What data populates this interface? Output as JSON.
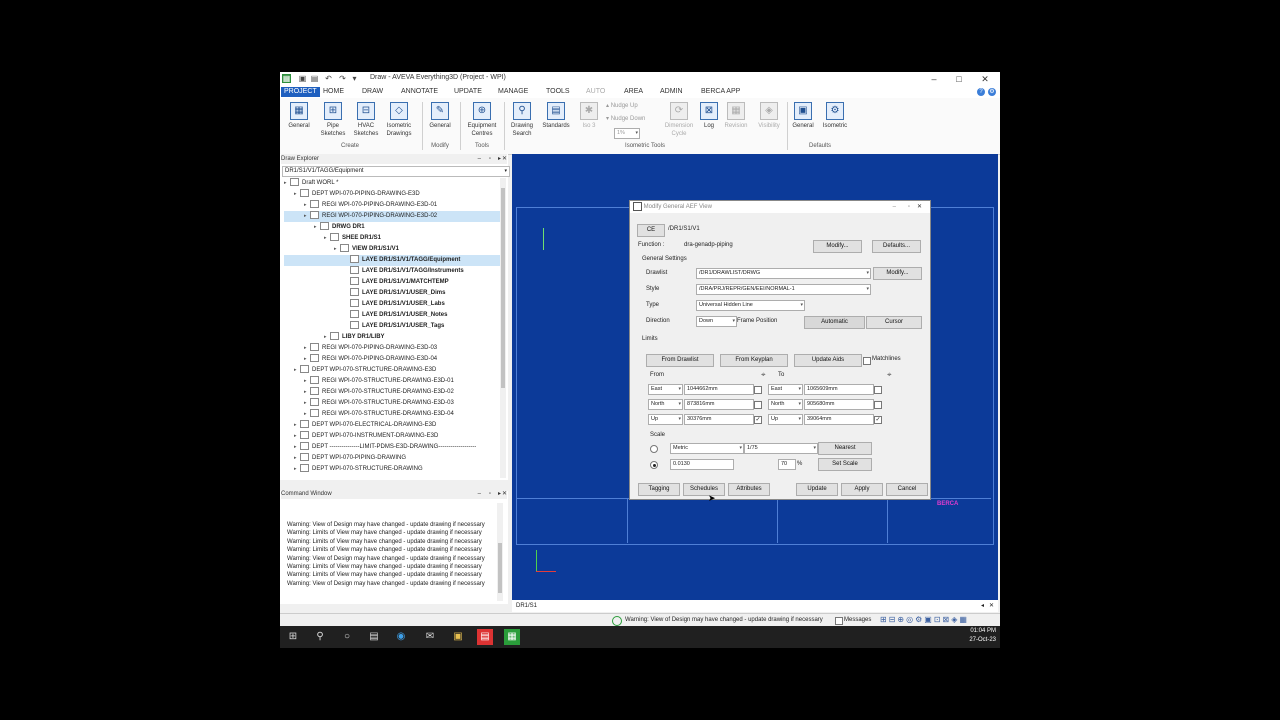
{
  "window": {
    "title": "Draw - AVEVA Everything3D (Project - WPI)",
    "controls": [
      "–",
      "□",
      "✕"
    ]
  },
  "menu": {
    "items": [
      "PROJECT",
      "HOME",
      "DRAW",
      "ANNOTATE",
      "UPDATE",
      "MANAGE",
      "TOOLS",
      "AUTO",
      "AREA",
      "ADMIN",
      "BERCA APP"
    ],
    "active": "PROJECT"
  },
  "ribbon": {
    "create": {
      "general": "General",
      "pipe": "Pipe Sketches",
      "hvac": "HVAC Sketches",
      "isometric": "Isometric Drawings",
      "group": "Create"
    },
    "modify": {
      "general": "General",
      "group": "Modify"
    },
    "tools": {
      "equipment": "Equipment Centres",
      "group": "Tools"
    },
    "drawing_search": "Drawing Search",
    "standards": "Standards",
    "iso3": "Iso 3",
    "nudge_up": "Nudge Up",
    "nudge_down": "Nudge Down",
    "percent": "1%",
    "dimension_cycle": "Dimension Cycle",
    "log": "Log",
    "revision": "Revision",
    "visibility": "Visibility",
    "isometric_tools_group": "Isometric Tools",
    "defaults": {
      "general": "General",
      "isometric": "Isometric",
      "group": "Defaults"
    }
  },
  "draw_explorer": {
    "title": "Draw Explorer",
    "path": "DR1/S1/V1/TAGG/Equipment",
    "tree": [
      {
        "text": "Draft WORL *",
        "level": 0,
        "bold": false
      },
      {
        "text": "DEPT WPI-070-PIPING-DRAWING-E3D",
        "level": 1,
        "bold": false
      },
      {
        "text": "REGI WPI-070-PIPING-DRAWING-E3D-01",
        "level": 2,
        "bold": false
      },
      {
        "text": "REGI WPI-070-PIPING-DRAWING-E3D-02",
        "level": 2,
        "bold": false,
        "selected": true
      },
      {
        "text": "DRWG DR1",
        "level": 3,
        "bold": true
      },
      {
        "text": "SHEE DR1/S1",
        "level": 4,
        "bold": true
      },
      {
        "text": "VIEW DR1/S1/V1",
        "level": 5,
        "bold": true
      },
      {
        "text": "LAYE DR1/S1/V1/TAGG/Equipment",
        "level": 6,
        "bold": true,
        "selected": true
      },
      {
        "text": "LAYE DR1/S1/V1/TAGG/Instruments",
        "level": 6,
        "bold": true
      },
      {
        "text": "LAYE DR1/S1/V1/MATCHTEMP",
        "level": 6,
        "bold": true
      },
      {
        "text": "LAYE DR1/S1/V1/USER_Dims",
        "level": 6,
        "bold": true
      },
      {
        "text": "LAYE DR1/S1/V1/USER_Labs",
        "level": 6,
        "bold": true
      },
      {
        "text": "LAYE DR1/S1/V1/USER_Notes",
        "level": 6,
        "bold": true
      },
      {
        "text": "LAYE DR1/S1/V1/USER_Tags",
        "level": 6,
        "bold": true
      },
      {
        "text": "LIBY DR1/LIBY",
        "level": 4,
        "bold": true
      },
      {
        "text": "REGI WPI-070-PIPING-DRAWING-E3D-03",
        "level": 2,
        "bold": false
      },
      {
        "text": "REGI WPI-070-PIPING-DRAWING-E3D-04",
        "level": 2,
        "bold": false
      },
      {
        "text": "DEPT WPI-070-STRUCTURE-DRAWING-E3D",
        "level": 1,
        "bold": false
      },
      {
        "text": "REGI WPI-070-STRUCTURE-DRAWING-E3D-01",
        "level": 2,
        "bold": false
      },
      {
        "text": "REGI WPI-070-STRUCTURE-DRAWING-E3D-02",
        "level": 2,
        "bold": false
      },
      {
        "text": "REGI WPI-070-STRUCTURE-DRAWING-E3D-03",
        "level": 2,
        "bold": false
      },
      {
        "text": "REGI WPI-070-STRUCTURE-DRAWING-E3D-04",
        "level": 2,
        "bold": false
      },
      {
        "text": "DEPT WPI-070-ELECTRICAL-DRAWING-E3D",
        "level": 1,
        "bold": false
      },
      {
        "text": "DEPT WPI-070-INSTRUMENT-DRAWING-E3D",
        "level": 1,
        "bold": false
      },
      {
        "text": "DEPT ---------------LIMIT-PDMS-E3D-DRAWING-------------------",
        "level": 1,
        "bold": false
      },
      {
        "text": "DEPT WPI-070-PIPING-DRAWING",
        "level": 1,
        "bold": false
      },
      {
        "text": "DEPT WPI-070-STRUCTURE-DRAWING",
        "level": 1,
        "bold": false
      }
    ]
  },
  "command_window": {
    "title": "Command Window",
    "lines": [
      "Warning: View of Design may have changed - update drawing if necessary",
      "Warning: Limits of View may have changed - update drawing if necessary",
      "Warning: Limits of View may have changed - update drawing if necessary",
      "Warning: Limits of View may have changed - update drawing if necessary",
      "Warning: View of Design may have changed - update drawing if necessary",
      "Warning: Limits of View may have changed - update drawing if necessary",
      "Warning: Limits of View may have changed - update drawing if necessary",
      "Warning: View of Design may have changed - update drawing if necessary"
    ]
  },
  "dialog": {
    "title": "Modify General AEF View",
    "ce_label": "CE",
    "ce_value": "/DR1/S1/V1",
    "function_label": "Function :",
    "function_value": "dra-genadp-piping",
    "modify1": "Modify...",
    "defaults": "Defaults...",
    "general_settings": "General Settings",
    "drawlist_label": "Drawlist",
    "drawlist_value": "/DR1/DRAWLIST/DRWG",
    "modify2": "Modify...",
    "style_label": "Style",
    "style_value": "/DRA/PRJ/REPR/GEN/EEI/NORMAL-1",
    "type_label": "Type",
    "type_value": "Universal Hidden Line",
    "direction_label": "Direction",
    "direction_value": "Down",
    "frame_position": "Frame Position",
    "automatic": "Automatic",
    "cursor": "Cursor",
    "limits": "Limits",
    "from_drawlist": "From Drawlist",
    "from_keyplan": "From Keyplan",
    "update_aids": "Update Aids",
    "matchlines": "Matchlines",
    "from_label": "From",
    "to_label": "To",
    "from_rows": [
      {
        "axis": "East",
        "value": "1044662mm",
        "checked": false
      },
      {
        "axis": "North",
        "value": "873816mm",
        "checked": false
      },
      {
        "axis": "Up",
        "value": "30376mm",
        "checked": true
      }
    ],
    "to_rows": [
      {
        "axis": "East",
        "value": "1065609mm",
        "checked": false
      },
      {
        "axis": "North",
        "value": "905680mm",
        "checked": false
      },
      {
        "axis": "Up",
        "value": "39064mm",
        "checked": true
      }
    ],
    "scale_label": "Scale",
    "scale_system": "Metric",
    "scale_ratio": "1/75",
    "nearest": "Nearest",
    "scale_value": "0.0130",
    "percent_value": "70",
    "percent_sign": "%",
    "set_scale": "Set Scale",
    "tagging": "Tagging",
    "schedules": "Schedules",
    "attributes": "Attributes",
    "update": "Update",
    "apply": "Apply",
    "cancel": "Cancel"
  },
  "canvas": {
    "tab": "DR1/S1",
    "title_block": "BERCA"
  },
  "statusbar": {
    "message": "Warning: View of Design may have changed - update drawing if necessary",
    "messages": "Messages"
  },
  "taskbar": {
    "time": "01:04 PM",
    "date": "27-Oct-23"
  },
  "colors": {
    "accent": "#1e5fbf",
    "canvas": "#0c3a99",
    "sheet_line": "#4f7fd6"
  }
}
